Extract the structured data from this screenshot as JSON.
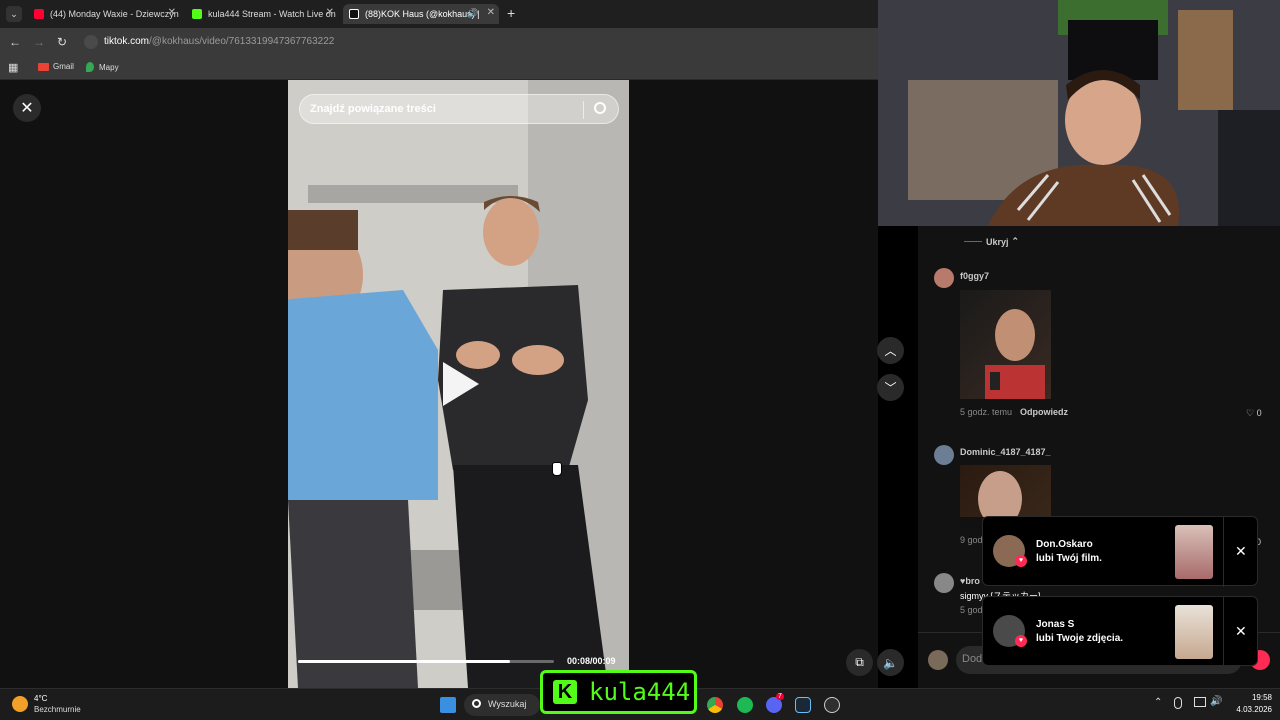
{
  "browser": {
    "tabs": [
      {
        "label": "(44) Monday Waxie - Dziewczyn",
        "color": "#ff0033"
      },
      {
        "label": "kula444 Stream - Watch Live on",
        "color": "#53fc18"
      },
      {
        "label": "(88)KOK Haus (@kokhaus) |",
        "color": "#ffffff"
      }
    ],
    "new_tab": "+",
    "url_host": "tiktok.com",
    "url_path": "/@kokhaus/video/7613319947367763222",
    "bookmarks": [
      {
        "label": "Gmail"
      },
      {
        "label": "Mapy"
      }
    ]
  },
  "video": {
    "search_placeholder": "Znajdź powiązane treści",
    "time": "00:08/00:09",
    "progress_fraction": 0.83
  },
  "comments": {
    "hide_label": "Ukryj",
    "items": [
      {
        "user": "f0ggy7",
        "time": "5 godz. temu",
        "reply": "Odpowiedz",
        "likes": "0"
      },
      {
        "user": "Dominic_4187_4187_",
        "time": "9 godz",
        "likes": "0"
      },
      {
        "user": "♥bro",
        "text": "sigmyy [ステッカー]",
        "time": "5 godz"
      }
    ],
    "input_placeholder": "Dod"
  },
  "notifications": [
    {
      "name": "Don.Oskaro",
      "text": "lubi Twój film."
    },
    {
      "name": "Jonas S",
      "text": "lubi Twoje zdjęcia."
    }
  ],
  "stream_overlay": {
    "badge": "K",
    "name": "kula444"
  },
  "taskbar": {
    "weather_temp": "4°C",
    "weather_desc": "Bezchmurnie",
    "search_label": "Wyszukaj",
    "time": "19:58",
    "date": "4.03.2026",
    "discord_badge": "7"
  }
}
